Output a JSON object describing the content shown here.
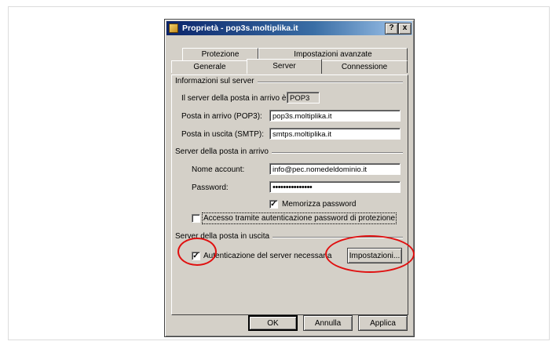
{
  "window": {
    "title": "Proprietà - pop3s.moltiplika.it",
    "help_btn": "?",
    "close_btn": "x"
  },
  "tabs": {
    "back": [
      "Protezione",
      "Impostazioni avanzate"
    ],
    "front": [
      "Generale",
      "Server",
      "Connessione"
    ],
    "active": "Server"
  },
  "server_info": {
    "heading": "Informazioni sul server",
    "incoming_type_label": "Il server della posta in arrivo è:",
    "incoming_type_value": "POP3",
    "incoming_label": "Posta in arrivo (POP3):",
    "incoming_value": "pop3s.moltiplika.it",
    "outgoing_label": "Posta in uscita (SMTP):",
    "outgoing_value": "smtps.moltiplika.it"
  },
  "incoming_server": {
    "heading": "Server della posta in arrivo",
    "account_label": "Nome account:",
    "account_value": "info@pec.nomedeldominio.it",
    "password_label": "Password:",
    "password_value": "•••••••••••••••",
    "remember_label": "Memorizza password",
    "remember_checked": "✓",
    "spa_label": "Accesso tramite autenticazione password di protezione",
    "spa_checked": ""
  },
  "outgoing_server": {
    "heading": "Server della posta in uscita",
    "auth_label": "Autenticazione del server necessaria",
    "auth_checked": "✓",
    "settings_button": "Impostazioni..."
  },
  "footer": {
    "ok": "OK",
    "cancel": "Annulla",
    "apply": "Applica"
  },
  "colors": {
    "dialog_face": "#d4d0c8",
    "titlebar_start": "#0a246a",
    "titlebar_end": "#a6caf0",
    "annotation_red": "#e01010"
  }
}
